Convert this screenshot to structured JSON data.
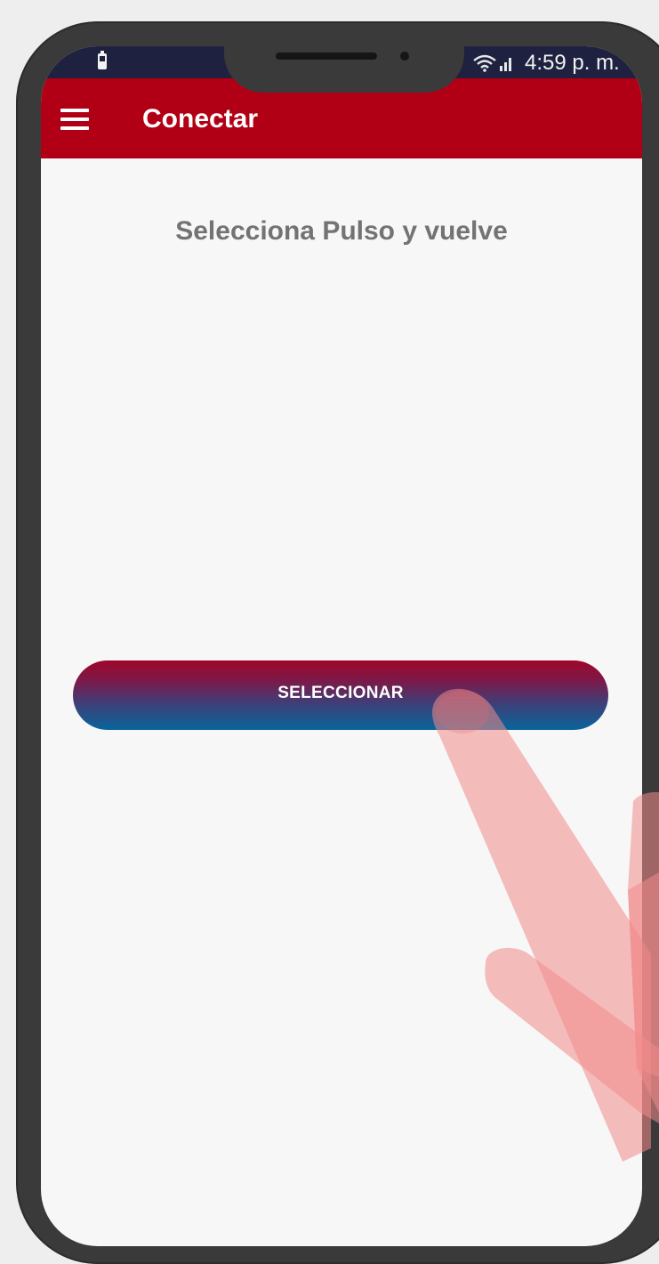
{
  "status_bar": {
    "time": "4:59 p. m.",
    "battery_icon": "battery-icon",
    "wifi_icon": "wifi-icon",
    "signal_icon": "signal-icon"
  },
  "app_bar": {
    "title": "Conectar",
    "menu_icon": "menu-icon",
    "background_color": "#b10016"
  },
  "main": {
    "instruction": "Selecciona Pulso y vuelve",
    "select_button_label": "SELECCIONAR",
    "button_gradient": [
      "#a0062a",
      "#08659b"
    ]
  },
  "overlay": {
    "hand_icon": "pointing-hand-icon",
    "hand_color": "#f28a8a"
  }
}
